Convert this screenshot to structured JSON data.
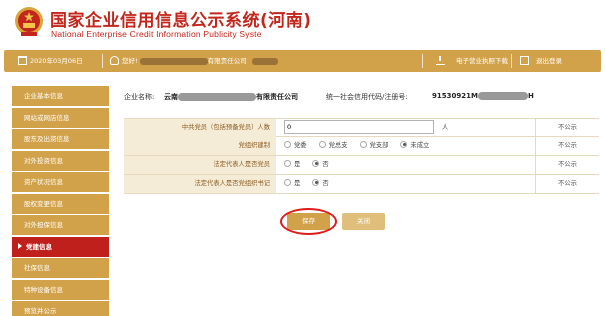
{
  "header": {
    "title": "国家企业信用信息公示系统",
    "region": "(河南)",
    "subtitle": "National Enterprise Credit Information Publicity Syste",
    "emblem_icon": "national-emblem-icon"
  },
  "infobar": {
    "date": "2020年03月06日",
    "welcome": "您好!",
    "welcome_suffix": "有限责任公司",
    "license_download": "电子营业执照下载",
    "logout": "退出登录",
    "icons": [
      "calendar-icon",
      "user-icon",
      "download-icon",
      "logout-icon"
    ]
  },
  "sidebar": {
    "items": [
      {
        "label": "企业基本信息",
        "active": false
      },
      {
        "label": "网站或网店信息",
        "active": false
      },
      {
        "label": "股东及出资信息",
        "active": false
      },
      {
        "label": "对外投资信息",
        "active": false
      },
      {
        "label": "资产状况信息",
        "active": false
      },
      {
        "label": "股权变更信息",
        "active": false
      },
      {
        "label": "对外担保信息",
        "active": false
      },
      {
        "label": "党建信息",
        "active": true
      },
      {
        "label": "社保信息",
        "active": false
      },
      {
        "label": "特种设备信息",
        "active": false
      },
      {
        "label": "预览并公示",
        "active": false
      }
    ]
  },
  "company": {
    "name_label": "企业名称:",
    "name_prefix": "云南",
    "name_suffix": "有限责任公司",
    "credit_label": "统一社会信用代码/注册号:",
    "credit_prefix": "91530921M",
    "credit_suffix": "H"
  },
  "form": {
    "rows": [
      {
        "label": "中共党员（包括预备党员）人数",
        "value": "0",
        "unit": "人",
        "publicity": "不公示"
      },
      {
        "label": "党组织建制",
        "options": [
          "党委",
          "党总支",
          "党支部",
          "未成立"
        ],
        "selected": "未成立",
        "publicity": "不公示"
      },
      {
        "label": "法定代表人是否党员",
        "options": [
          "是",
          "否"
        ],
        "selected": "否",
        "publicity": "不公示"
      },
      {
        "label": "法定代表人是否党组织书记",
        "options": [
          "是",
          "否"
        ],
        "selected": "否",
        "publicity": "不公示"
      }
    ]
  },
  "buttons": {
    "save": "保存",
    "close": "关闭"
  },
  "colors": {
    "brand_red": "#c3261c",
    "gold": "#d2a24a",
    "active_red": "#c0201c",
    "highlight_ring": "#e01b1b"
  }
}
